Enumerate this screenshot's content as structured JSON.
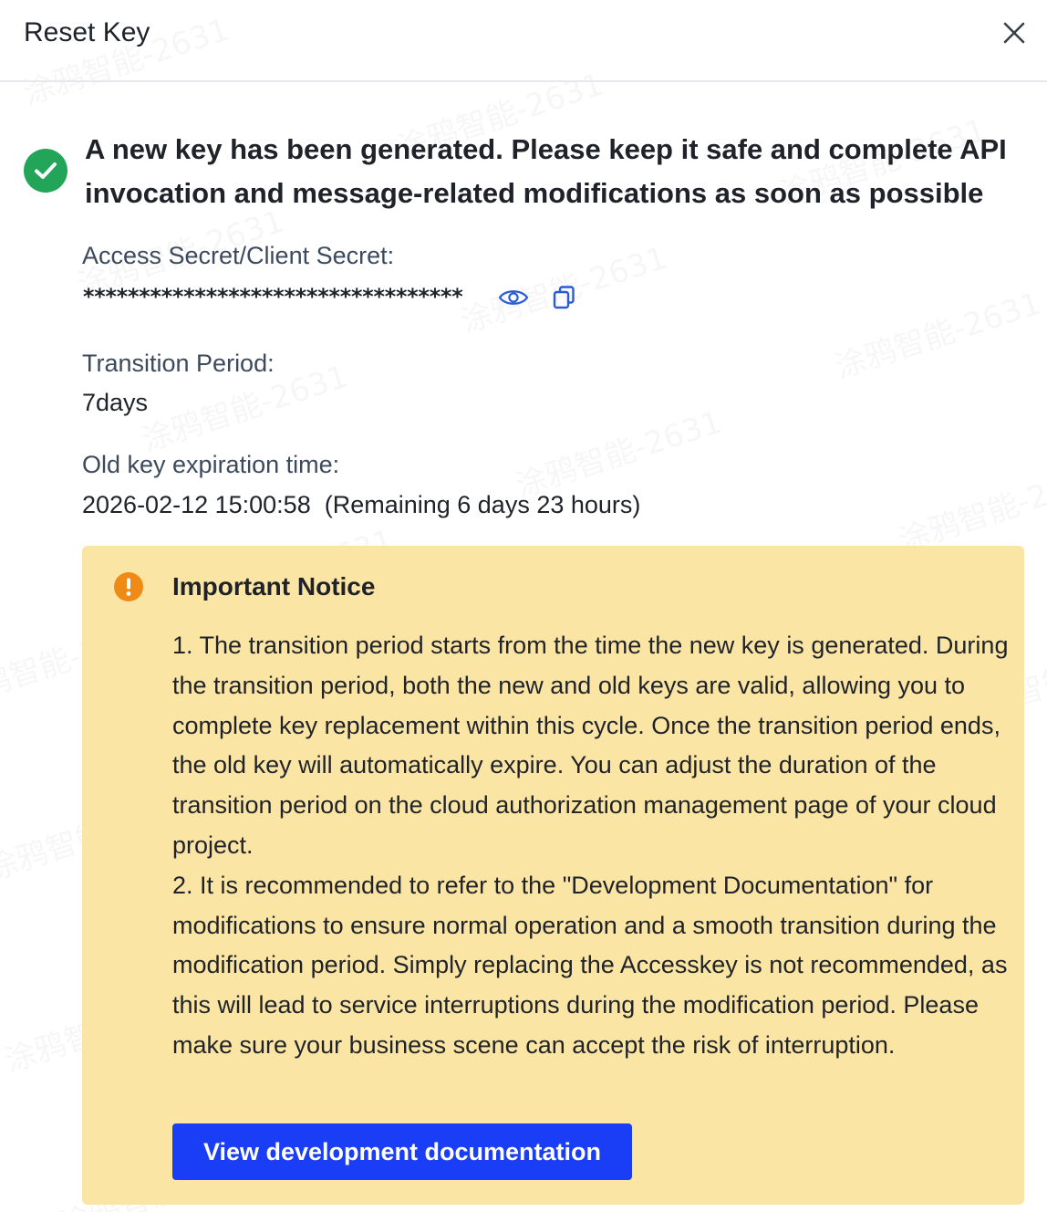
{
  "header": {
    "title": "Reset Key",
    "close_icon": "close-icon"
  },
  "success": {
    "icon": "check-circle-icon",
    "color": "#22a559",
    "message": "A new key has been generated. Please keep it safe and complete API invocation and message-related modifications as soon as possible"
  },
  "secret": {
    "label": "Access Secret/Client Secret:",
    "masked_value": "**********************************",
    "reveal_icon": "eye-icon",
    "copy_icon": "copy-icon"
  },
  "transition": {
    "label": "Transition Period:",
    "value": "7days"
  },
  "expiration": {
    "label": "Old key expiration time:",
    "value": "2026-02-12 15:00:58  (Remaining 6 days 23 hours)"
  },
  "notice": {
    "icon": "warning-circle-icon",
    "background": "#fbe5a4",
    "title": "Important Notice",
    "paragraphs": [
      "1. The transition period starts from the time the new key is generated. During the transition period, both the new and old keys are valid, allowing you to complete key replacement within this cycle. Once the transition period ends, the old key will automatically expire. You can adjust the duration of the transition period on the cloud authorization management page of your cloud project.",
      "2. It is recommended to refer to the \"Development Documentation\" for modifications to ensure normal operation and a smooth transition during the modification period. Simply replacing the Accesskey is not recommended, as this will lead to service interruptions during the modification period. Please make sure your business scene can accept the risk of interruption."
    ],
    "button_label": "View development documentation",
    "button_color": "#1a3ef5"
  },
  "watermark": {
    "text": "涂鸦智能-2631"
  },
  "accent": "#2a5bd7"
}
